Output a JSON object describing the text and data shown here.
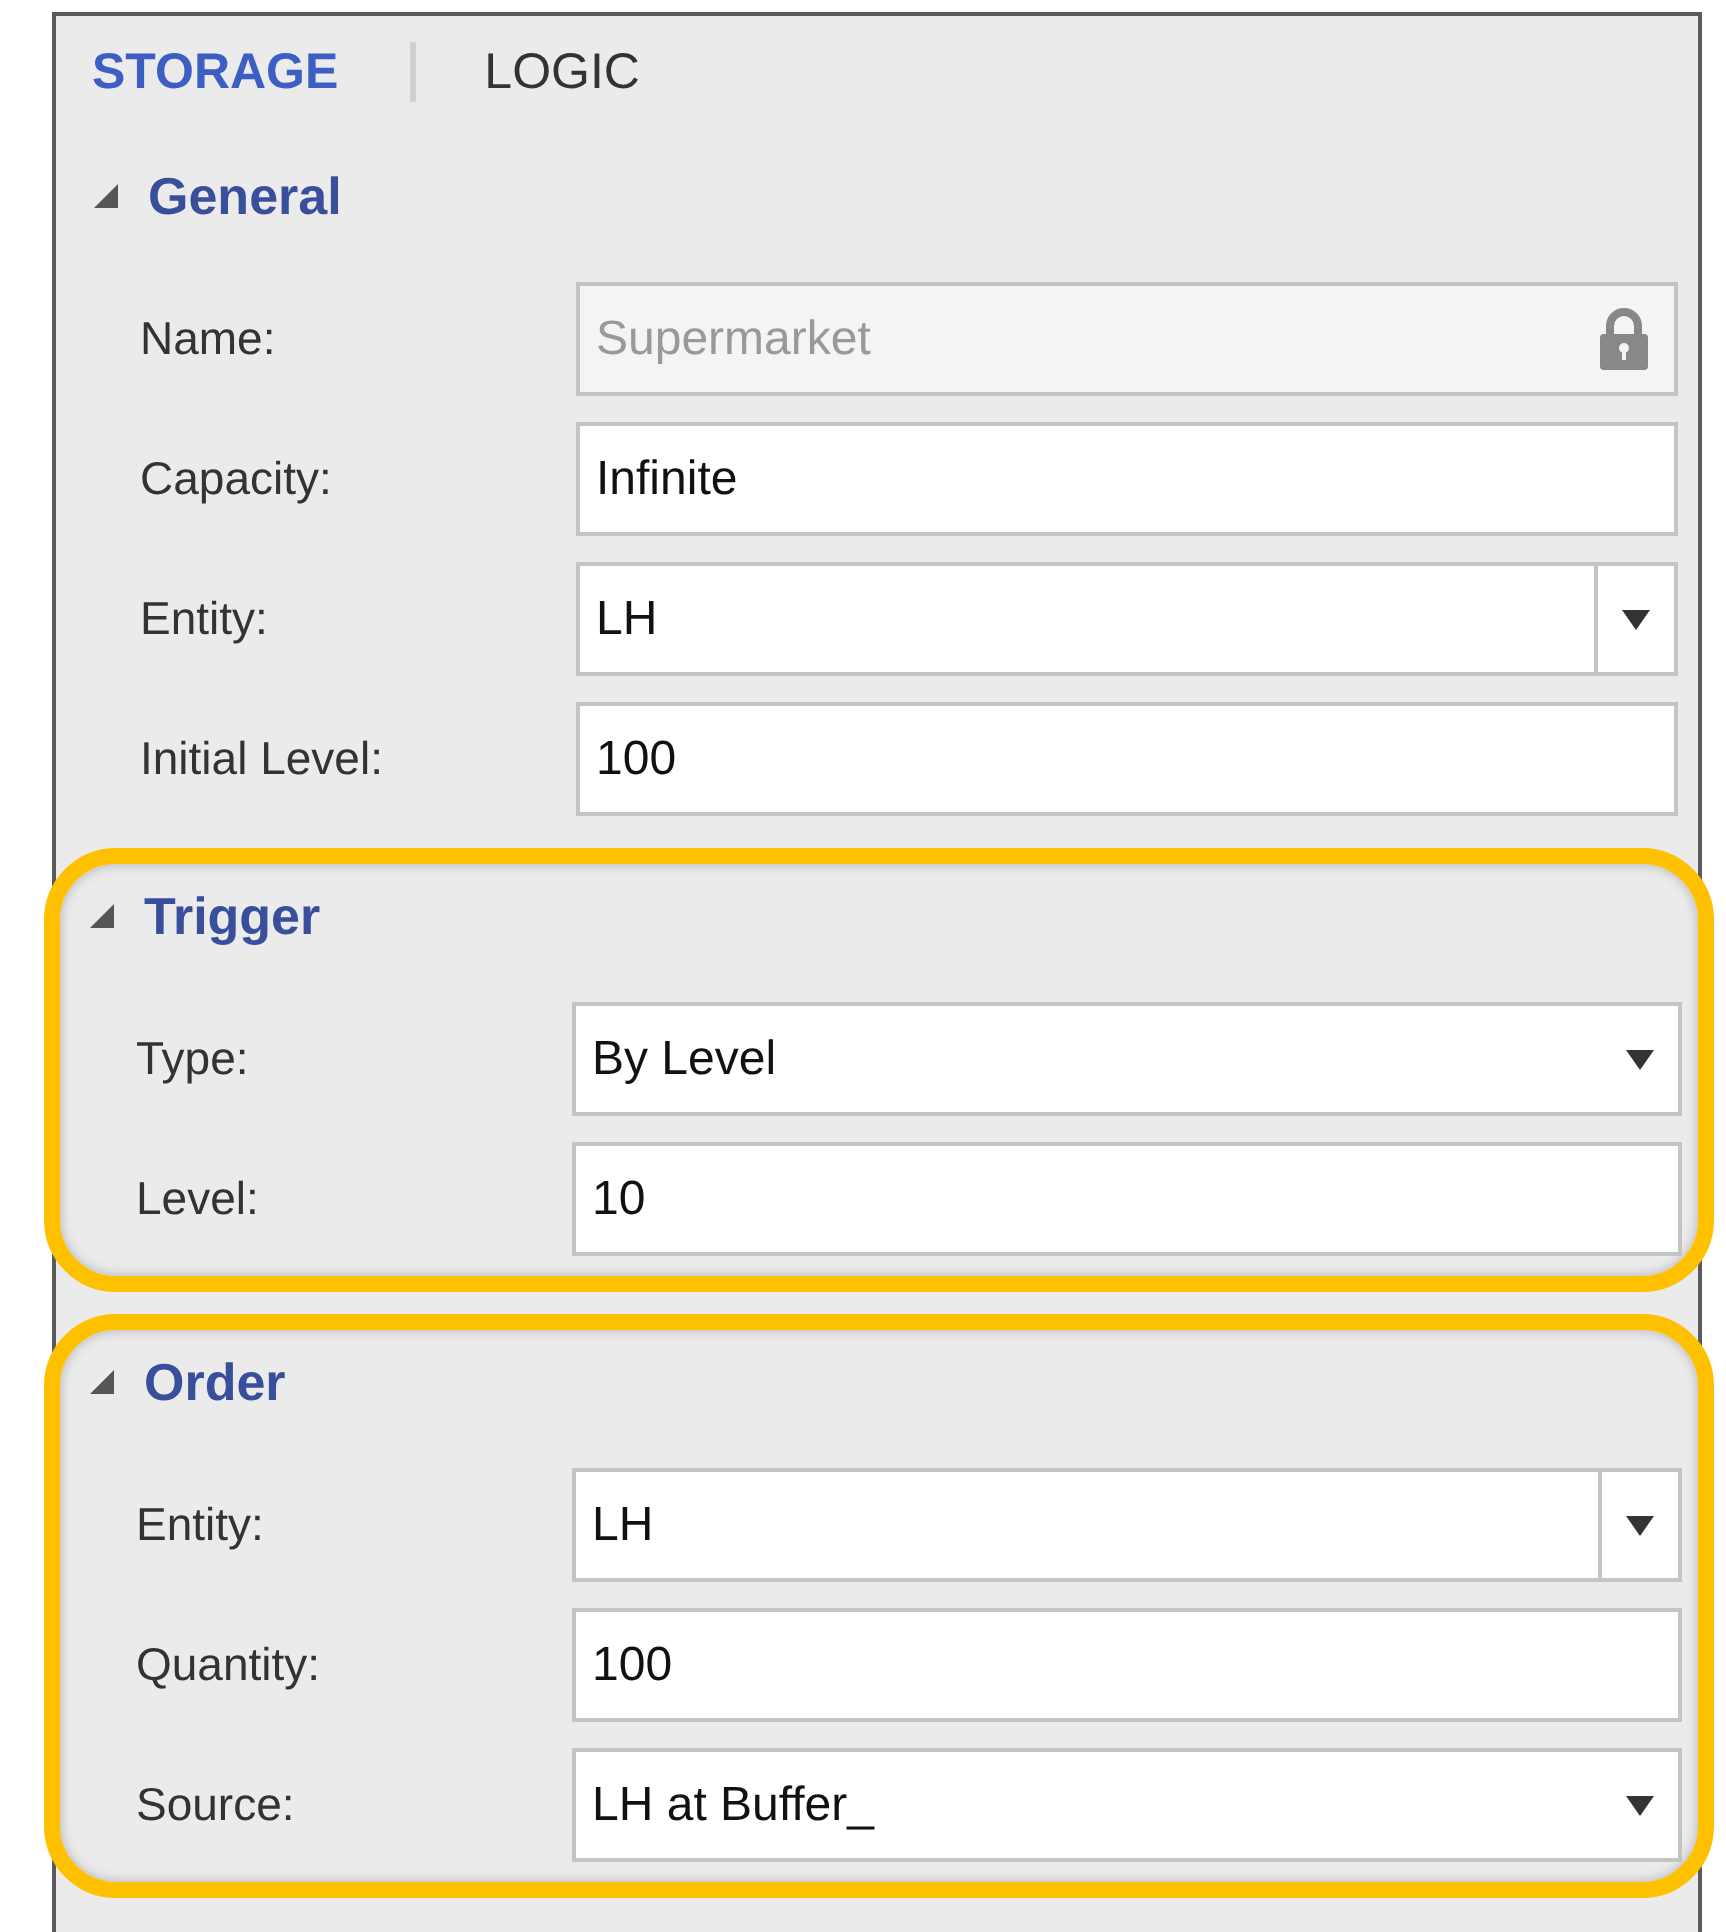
{
  "tabs": [
    {
      "label": "STORAGE",
      "selected": true
    },
    {
      "label": "LOGIC",
      "selected": false
    }
  ],
  "sections": [
    {
      "title": "General",
      "expanded": true,
      "highlighted": false,
      "fields": [
        {
          "label": "Name:",
          "kind": "locked",
          "value": "Supermarket"
        },
        {
          "label": "Capacity:",
          "kind": "text",
          "value": "Infinite"
        },
        {
          "label": "Entity:",
          "kind": "combo",
          "value": "LH"
        },
        {
          "label": "Initial Level:",
          "kind": "text",
          "value": "100"
        }
      ]
    },
    {
      "title": "Trigger",
      "expanded": true,
      "highlighted": true,
      "fields": [
        {
          "label": "Type:",
          "kind": "select",
          "value": "By Level"
        },
        {
          "label": "Level:",
          "kind": "text",
          "value": "10"
        }
      ]
    },
    {
      "title": "Order",
      "expanded": true,
      "highlighted": true,
      "fields": [
        {
          "label": "Entity:",
          "kind": "combo",
          "value": "LH"
        },
        {
          "label": "Quantity:",
          "kind": "text",
          "value": "100"
        },
        {
          "label": "Source:",
          "kind": "select",
          "value": "LH at Buffer_"
        }
      ]
    }
  ]
}
